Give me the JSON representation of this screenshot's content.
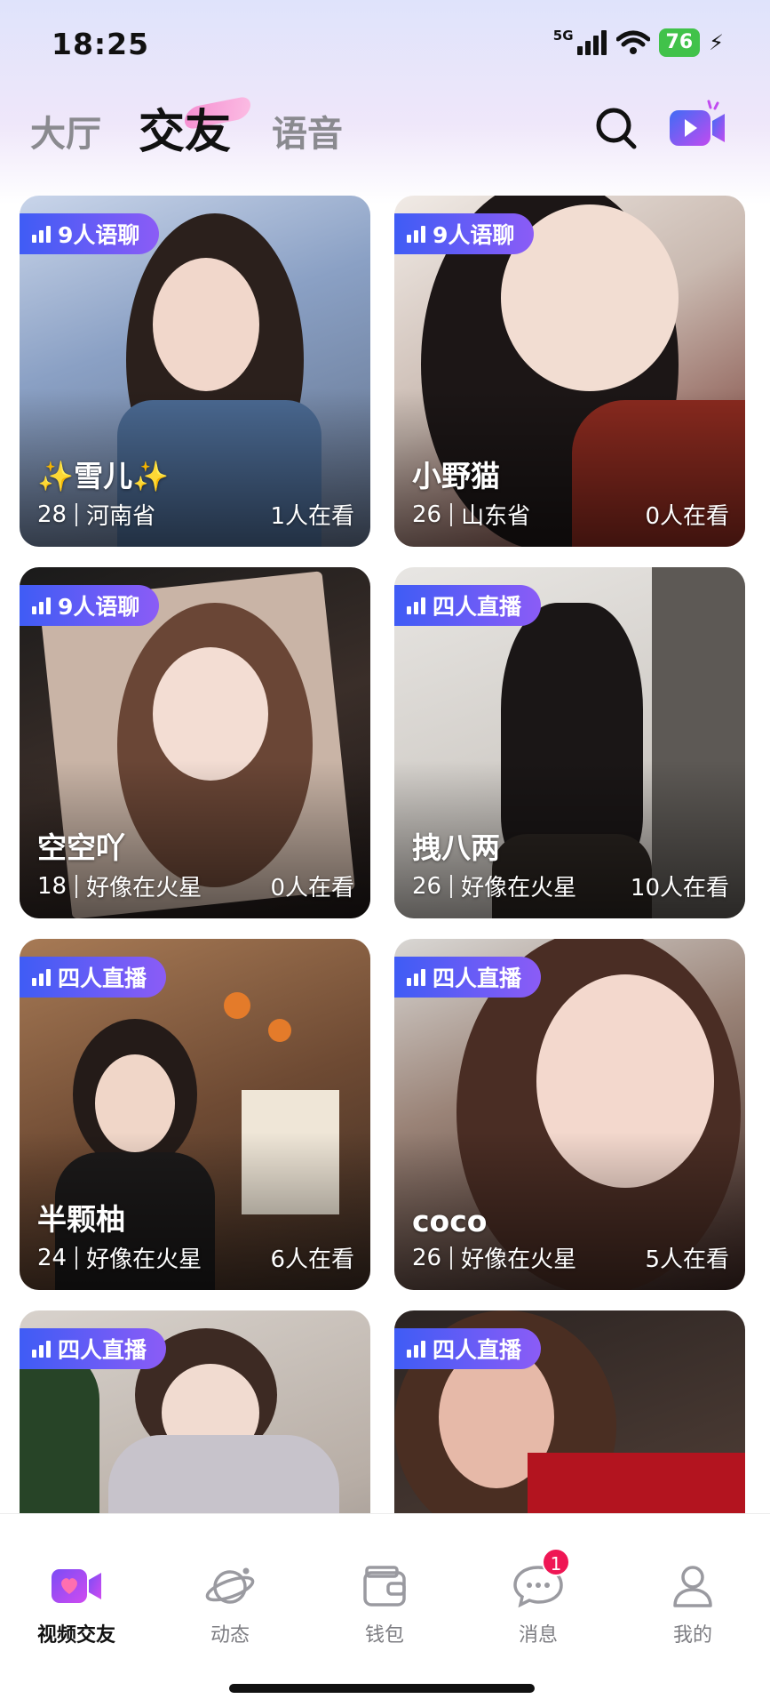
{
  "status_bar": {
    "time": "18:25",
    "network": "5G",
    "battery": "76"
  },
  "header": {
    "tabs": [
      {
        "label": "大厅",
        "active": false
      },
      {
        "label": "交友",
        "active": true
      },
      {
        "label": "语音",
        "active": false
      }
    ],
    "search_icon": "search-icon",
    "video_icon": "video-camera-icon"
  },
  "cards": [
    {
      "badge": "9人语聊",
      "name": "✨雪儿✨",
      "age": "28",
      "location": "河南省",
      "viewers": "1人在看"
    },
    {
      "badge": "9人语聊",
      "name": "小野猫",
      "age": "26",
      "location": "山东省",
      "viewers": "0人在看"
    },
    {
      "badge": "9人语聊",
      "name": "空空吖",
      "age": "18",
      "location": "好像在火星",
      "viewers": "0人在看"
    },
    {
      "badge": "四人直播",
      "name": "拽八两",
      "age": "26",
      "location": "好像在火星",
      "viewers": "10人在看"
    },
    {
      "badge": "四人直播",
      "name": "半颗柚",
      "age": "24",
      "location": "好像在火星",
      "viewers": "6人在看"
    },
    {
      "badge": "四人直播",
      "name": "coco",
      "age": "26",
      "location": "好像在火星",
      "viewers": "5人在看"
    },
    {
      "badge": "四人直播"
    },
    {
      "badge": "四人直播"
    }
  ],
  "bottom_nav": [
    {
      "label": "视频交友",
      "icon": "video-heart-icon",
      "active": true
    },
    {
      "label": "动态",
      "icon": "planet-icon",
      "active": false
    },
    {
      "label": "钱包",
      "icon": "wallet-icon",
      "active": false
    },
    {
      "label": "消息",
      "icon": "chat-bubble-icon",
      "active": false,
      "badge": "1"
    },
    {
      "label": "我的",
      "icon": "profile-icon",
      "active": false
    }
  ],
  "colors": {
    "badge_start": "#3f5cf5",
    "badge_end": "#8b5cf6",
    "accent_pink": "#f77ac7",
    "notification": "#ef1654"
  }
}
